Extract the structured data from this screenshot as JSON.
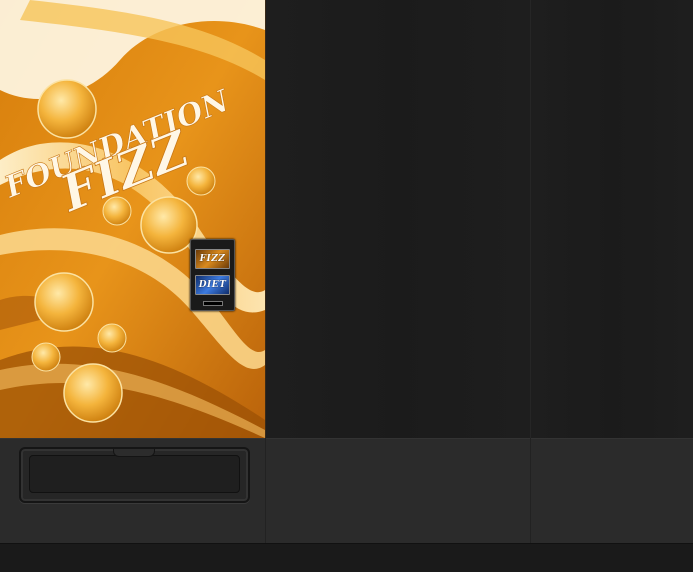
{
  "machine": {
    "brand_line1": "FOUNDATION",
    "brand_line2": "FIZZ",
    "colors": {
      "primary": "#e08a12",
      "highlight": "#fde9b0",
      "shadow": "#8a4a05"
    }
  },
  "panel": {
    "buttons": [
      {
        "label": "FIZZ",
        "color": "#c77b1a"
      },
      {
        "label": "DIET",
        "color": "#2f6fd0"
      }
    ]
  },
  "tray": {
    "icon": "dispense-tray"
  }
}
